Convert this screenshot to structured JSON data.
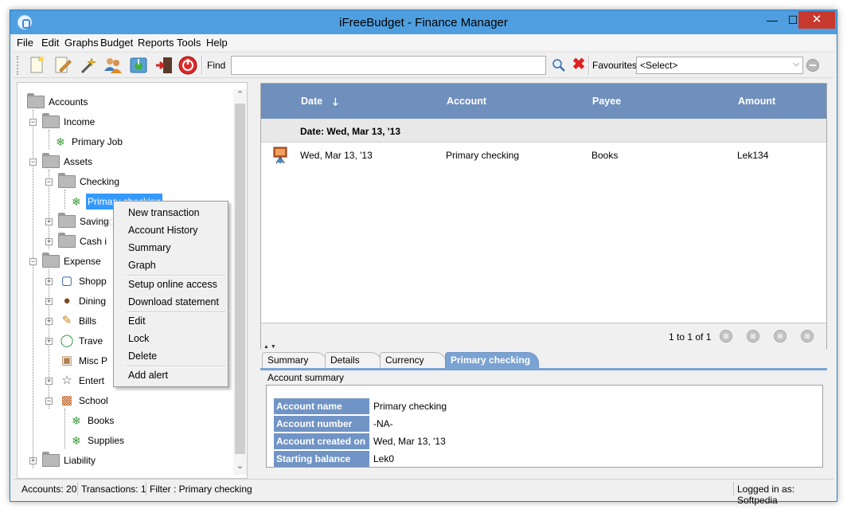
{
  "window": {
    "title": "iFreeBudget - Finance Manager"
  },
  "menubar": {
    "items": [
      "File",
      "Edit",
      "Graphs",
      "Budget",
      "Reports",
      "Tools",
      "Help"
    ]
  },
  "toolbar": {
    "find_label": "Find",
    "find_value": "",
    "favourites_label": "Favourites",
    "favourites_selected": "<Select>"
  },
  "tree": {
    "root": "Accounts",
    "income": "Income",
    "primary_job": "Primary Job",
    "assets": "Assets",
    "checking": "Checking",
    "primary_checking": "Primary checking",
    "savings": "Saving",
    "cash": "Cash i",
    "expense": "Expense",
    "shopping": "Shopp",
    "dining": "Dining",
    "bills": "Bills",
    "travel": "Trave",
    "misc": "Misc P",
    "entertainment": "Entert",
    "school": "School",
    "books": "Books",
    "supplies": "Supplies",
    "liability": "Liability"
  },
  "context_menu": {
    "items": [
      "New transaction",
      "Account History",
      "Summary",
      "Graph",
      "Setup online access",
      "Download statement",
      "Edit",
      "Lock",
      "Delete",
      "Add alert"
    ]
  },
  "transactions": {
    "columns": {
      "date": "Date",
      "account": "Account",
      "payee": "Payee",
      "amount": "Amount"
    },
    "group_label": "Date: Wed, Mar 13, '13",
    "rows": [
      {
        "date": "Wed, Mar 13, '13",
        "account": "Primary checking",
        "payee": "Books",
        "amount": "Lek134"
      }
    ],
    "pager_text": "1 to 1 of 1"
  },
  "tabs": {
    "items": [
      "Summary",
      "Details",
      "Currency",
      "Primary checking"
    ],
    "active": "Primary checking"
  },
  "account_summary": {
    "caption": "Account summary",
    "rows": [
      {
        "key": "Account name",
        "value": "Primary checking"
      },
      {
        "key": "Account number",
        "value": "-NA-"
      },
      {
        "key": "Account created on",
        "value": "Wed, Mar 13, '13"
      },
      {
        "key": "Starting balance",
        "value": "Lek0"
      }
    ]
  },
  "statusbar": {
    "accounts": "Accounts: 20",
    "transactions": "Transactions: 1",
    "filter": "Filter : Primary checking",
    "logged_in": "Logged in as: Softpedia"
  },
  "colors": {
    "titlebar": "#4f9fe0",
    "grid_header": "#6f8fbd",
    "selection": "#3399ff",
    "summary_key": "#7194c6"
  },
  "watermark": "SOFTPEDIA"
}
